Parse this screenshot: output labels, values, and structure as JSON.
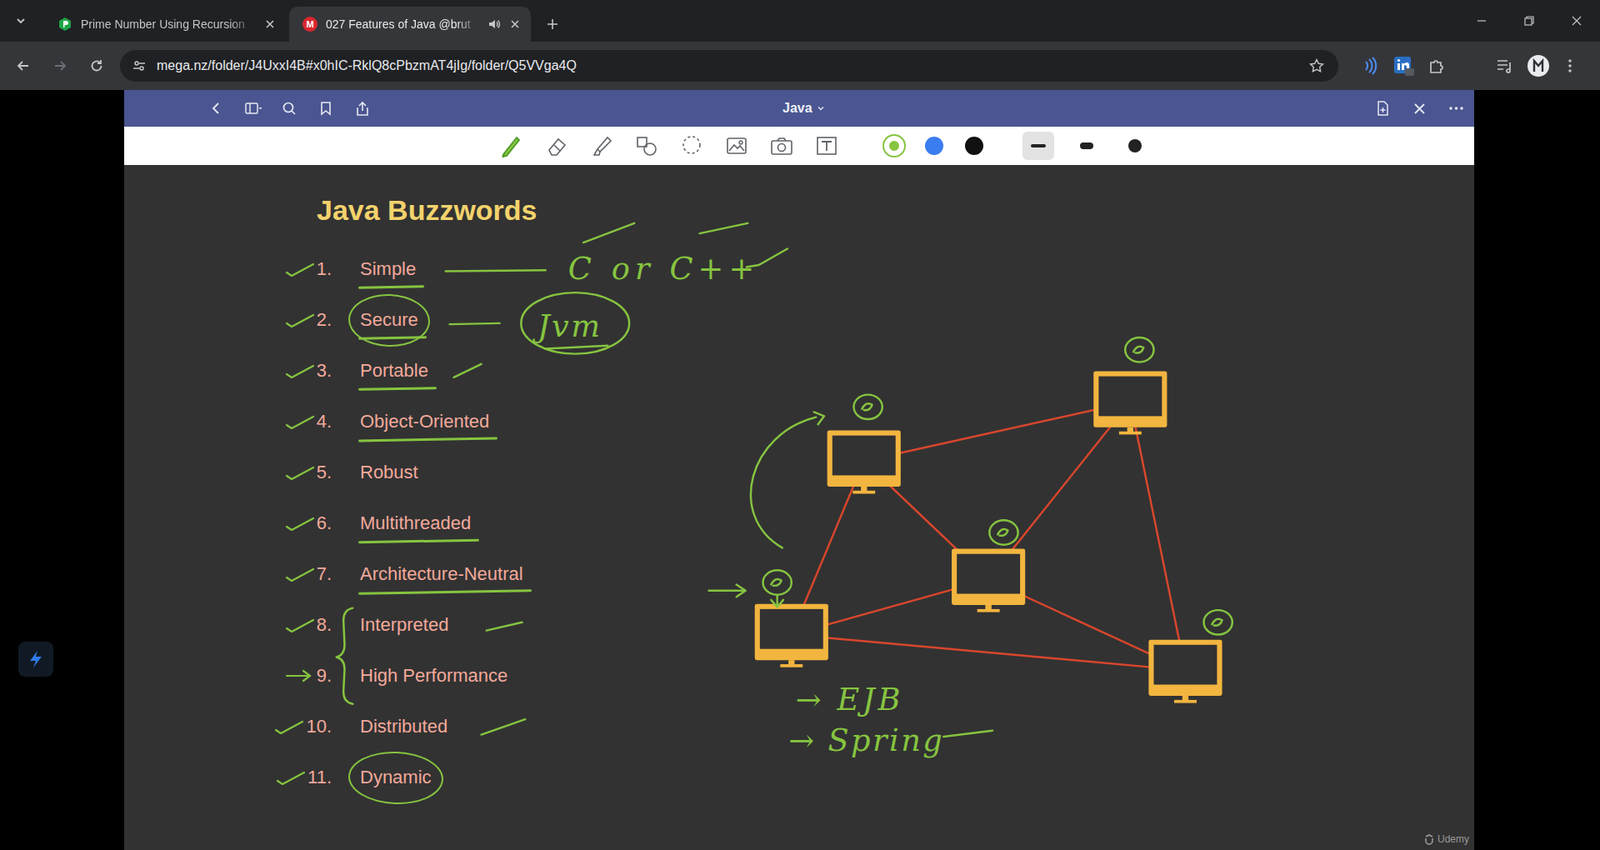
{
  "browser": {
    "tabs": [
      {
        "label": "Prime Number Using Recursion",
        "selected": false,
        "audio": false,
        "icon": "green"
      },
      {
        "label": "027 Features of Java @brut",
        "selected": true,
        "audio": true,
        "icon": "mega",
        "icon_text": "M"
      }
    ],
    "address": "mega.nz/folder/J4UxxI4B#x0hIC-RklQ8cPbzmAT4jIg/folder/Q5VVga4Q",
    "forward_disabled": true
  },
  "app": {
    "title": "Java",
    "tools": [
      {
        "kind": "pen",
        "selected": true
      },
      {
        "kind": "eraser",
        "selected": false
      },
      {
        "kind": "highlighter",
        "selected": false
      },
      {
        "kind": "shapes",
        "selected": false
      },
      {
        "kind": "lasso",
        "selected": false
      },
      {
        "kind": "image",
        "selected": false
      },
      {
        "kind": "camera",
        "selected": false
      },
      {
        "kind": "text",
        "selected": false
      }
    ],
    "colors": [
      {
        "color": "#86c440",
        "selected": true
      },
      {
        "color": "#3b7cf0",
        "selected": false
      },
      {
        "color": "#111111",
        "selected": false
      }
    ],
    "widths": [
      {
        "kind": "thin",
        "selected": true
      },
      {
        "kind": "medium",
        "selected": false
      },
      {
        "kind": "thick",
        "selected": false
      }
    ]
  },
  "slide": {
    "title": "Java Buzzwords",
    "items": [
      {
        "number": "1.",
        "label": "Simple",
        "kind": "check",
        "underlined": true,
        "circled": false
      },
      {
        "number": "2.",
        "label": "Secure",
        "kind": "check",
        "underlined": true,
        "circled": true
      },
      {
        "number": "3.",
        "label": "Portable",
        "kind": "check",
        "underlined": true,
        "circled": false
      },
      {
        "number": "4.",
        "label": "Object-Oriented",
        "kind": "check",
        "underlined": true,
        "circled": false
      },
      {
        "number": "5.",
        "label": "Robust",
        "kind": "check",
        "underlined": false,
        "circled": false
      },
      {
        "number": "6.",
        "label": "Multithreaded",
        "kind": "check",
        "underlined": true,
        "circled": false
      },
      {
        "number": "7.",
        "label": "Architecture-Neutral",
        "kind": "check",
        "underlined": true,
        "circled": false
      },
      {
        "number": "8.",
        "label": "Interpreted",
        "kind": "check",
        "underlined": false,
        "circled": false
      },
      {
        "number": "9.",
        "label": "High Performance",
        "kind": "arrow",
        "underlined": false,
        "circled": false
      },
      {
        "number": "10.",
        "label": "Distributed",
        "kind": "check",
        "underlined": false,
        "circled": false
      },
      {
        "number": "11.",
        "label": "Dynamic",
        "kind": "check",
        "underlined": false,
        "circled": true
      }
    ],
    "notes": [
      "C or C++",
      "Jvm",
      "→ EJB",
      "→ Spring"
    ],
    "watermark": "Udemy"
  }
}
